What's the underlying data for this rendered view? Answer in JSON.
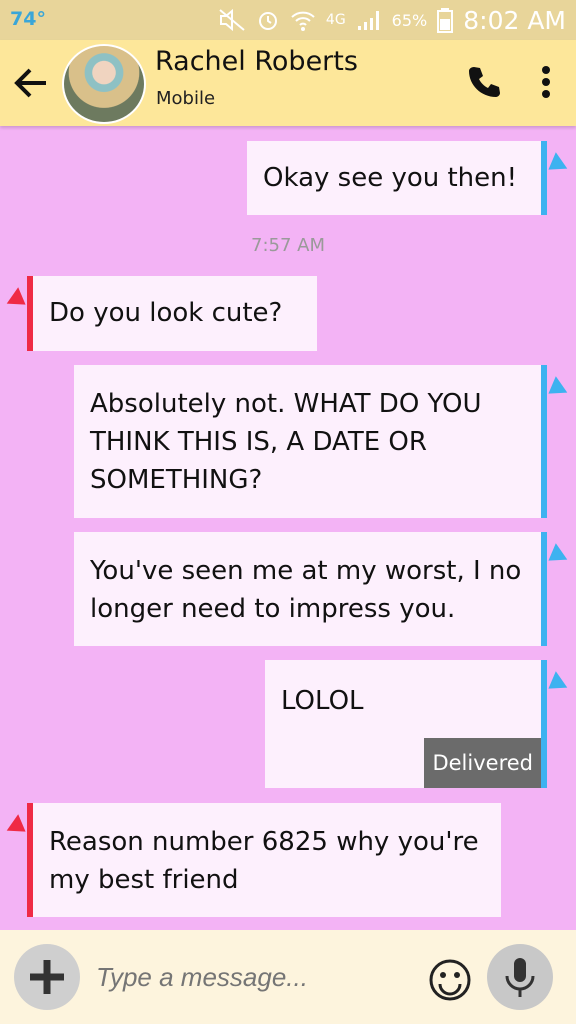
{
  "status_bar": {
    "temperature": "74°",
    "network": "4G",
    "battery_percent": "65%",
    "time": "8:02 AM"
  },
  "header": {
    "contact_name": "Rachel Roberts",
    "contact_subtitle": "Mobile",
    "back_icon": "arrow-left-icon",
    "call_icon": "phone-icon",
    "menu_icon": "more-vertical-icon"
  },
  "colors": {
    "background": "#f3b3f5",
    "header": "#fde79a",
    "outgoing_accent": "#3db2f0",
    "incoming_accent": "#ef2a45",
    "bubble": "#fdf0fd"
  },
  "messages": [
    {
      "direction": "out",
      "text": "Okay see you then!"
    },
    {
      "type": "timestamp",
      "text": "7:57 AM"
    },
    {
      "direction": "in",
      "text": "Do you look cute?"
    },
    {
      "direction": "out",
      "text": "Absolutely not. WHAT DO YOU THINK THIS IS, A DATE OR SOMETHING?"
    },
    {
      "direction": "out",
      "text": "You've seen me at my worst, I no longer need to impress you."
    },
    {
      "direction": "out",
      "text": "LOLOL",
      "status": "Delivered"
    },
    {
      "direction": "in",
      "text": "Reason number 6825 why you're my best friend"
    }
  ],
  "composer": {
    "placeholder": "Type a message...",
    "attach_icon": "plus-icon",
    "emoji_icon": "smiley-icon",
    "mic_icon": "microphone-icon"
  }
}
